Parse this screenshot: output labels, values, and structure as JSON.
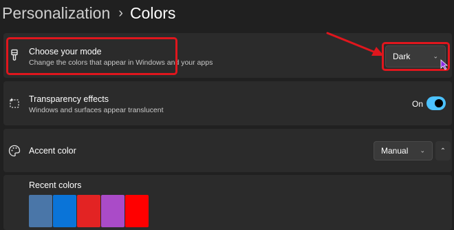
{
  "breadcrumb": {
    "parent": "Personalization",
    "separator": "›",
    "current": "Colors"
  },
  "mode": {
    "title": "Choose your mode",
    "description": "Change the colors that appear in Windows and your apps",
    "selected": "Dark"
  },
  "transparency": {
    "title": "Transparency effects",
    "description": "Windows and surfaces appear translucent",
    "state_label": "On",
    "enabled": true
  },
  "accent": {
    "title": "Accent color",
    "selected": "Manual"
  },
  "recent": {
    "title": "Recent colors",
    "swatches": [
      "#4a76a8",
      "#0a74d8",
      "#e32323",
      "#aa4bc8",
      "#ff0000"
    ]
  },
  "colors": {
    "highlight": "#e0161d",
    "toggle_on": "#4cc2ff",
    "background": "#202020",
    "card": "#2b2b2b"
  },
  "icons": [
    "brush-icon",
    "sparkle-icon",
    "palette-icon",
    "chevron-down-icon",
    "chevron-up-icon",
    "arrow-annotation-icon",
    "mouse-pointer-icon"
  ]
}
